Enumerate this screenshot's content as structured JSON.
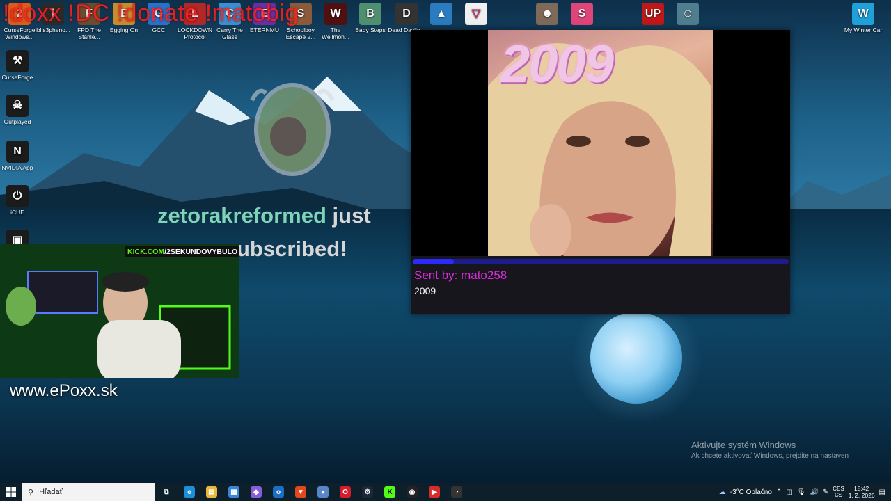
{
  "desktop_icons": [
    {
      "label": "CurseForge Windows...",
      "color": "#e05a1c",
      "glyph": "2"
    },
    {
      "label": "iblis3pheno...",
      "color": "#2a2a2a",
      "glyph": "i"
    },
    {
      "label": "FPD The Stanle...",
      "color": "#6c4b2f",
      "glyph": "F"
    },
    {
      "label": "Egging On",
      "color": "#c98b2c",
      "glyph": "E"
    },
    {
      "label": "GCC",
      "color": "#2c6fc9",
      "glyph": "G"
    },
    {
      "label": "LOCKDOWN Protocol",
      "color": "#b02828",
      "glyph": "L"
    },
    {
      "label": "Carry The Glass",
      "color": "#3c8ed0",
      "glyph": "C"
    },
    {
      "label": "ETERNMU",
      "color": "#6b2fa0",
      "glyph": "E"
    },
    {
      "label": "Schoolboy Escape 2...",
      "color": "#8a5a3a",
      "glyph": "S"
    },
    {
      "label": "The Wellmon...",
      "color": "#501010",
      "glyph": "W"
    },
    {
      "label": "Baby Steps",
      "color": "#4f8f6f",
      "glyph": "B"
    },
    {
      "label": "Dead Daylig...",
      "color": "#333333",
      "glyph": "D"
    },
    {
      "label": "",
      "color": "#2b7bc0",
      "glyph": "▲"
    },
    {
      "label": "",
      "color": "#f0f0f0",
      "glyph": "▽"
    },
    {
      "label": "",
      "color": "#7f6a5a",
      "glyph": "☻"
    },
    {
      "label": "",
      "color": "#e0457a",
      "glyph": "S"
    },
    {
      "label": "",
      "color": "#c01818",
      "glyph": "UP"
    },
    {
      "label": "",
      "color": "#4f7f8f",
      "glyph": "☺"
    },
    {
      "label": "My Winter Car",
      "color": "#1ea0d8",
      "glyph": "W"
    }
  ],
  "side_icons": [
    {
      "label": "CurseForge",
      "color": "#1b1b1b",
      "glyph": "⚒"
    },
    {
      "label": "Outplayed",
      "color": "#1b1b1b",
      "glyph": "☠"
    },
    {
      "label": "NVIDIA App",
      "color": "#1b1b1b",
      "glyph": "N"
    },
    {
      "label": "iCUE",
      "color": "#1b1b1b",
      "glyph": "⏻"
    },
    {
      "label": "",
      "color": "#1b1b1b",
      "glyph": "▣"
    }
  ],
  "overlay": {
    "marquee": "!doxx !DC !donate !matobig",
    "sub_user": "zetorakreformed",
    "sub_rest": "just",
    "sub_line2": "ubscribed!",
    "kick_prefix": "KICK.COM",
    "kick_rest": "/2SEKUNDOVYBULO",
    "website": "www.ePoxx.sk"
  },
  "media_popup": {
    "cover_title": "2009",
    "progress_fraction": 0.11,
    "sent_by": "Sent by: mato258",
    "message": "2009"
  },
  "watermark": {
    "line1": "Aktivujte systém Windows",
    "line2": "Ak chcete aktivovať Windows, prejdite na nastaven"
  },
  "taskbar": {
    "search_placeholder": "Hľadať",
    "apps": [
      {
        "name": "task-view",
        "glyph": "⧉",
        "color": "transparent"
      },
      {
        "name": "edge",
        "glyph": "e",
        "color": "#1b8fd8"
      },
      {
        "name": "file-explorer",
        "glyph": "▤",
        "color": "#e8b93a"
      },
      {
        "name": "store",
        "glyph": "▦",
        "color": "#3a86d8"
      },
      {
        "name": "copilot",
        "glyph": "◆",
        "color": "#8a5cd8"
      },
      {
        "name": "outlook",
        "glyph": "o",
        "color": "#1a6ec4"
      },
      {
        "name": "brave",
        "glyph": "▼",
        "color": "#e2481e"
      },
      {
        "name": "app-blue",
        "glyph": "●",
        "color": "#5a86c8"
      },
      {
        "name": "opera",
        "glyph": "O",
        "color": "#d81c2c"
      },
      {
        "name": "steam",
        "glyph": "⚙",
        "color": "#1b2838"
      },
      {
        "name": "kick",
        "glyph": "K",
        "color": "#53fc18"
      },
      {
        "name": "obs",
        "glyph": "◉",
        "color": "#222222"
      },
      {
        "name": "app-red",
        "glyph": "▶",
        "color": "#d82c2c"
      },
      {
        "name": "app-gauge",
        "glyph": "◔",
        "color": "#333333"
      }
    ],
    "weather": "-3°C  Oblačno",
    "lang_top": "CES",
    "lang_bottom": "CS",
    "time": "18:42",
    "date": "1. 2. 2026"
  }
}
